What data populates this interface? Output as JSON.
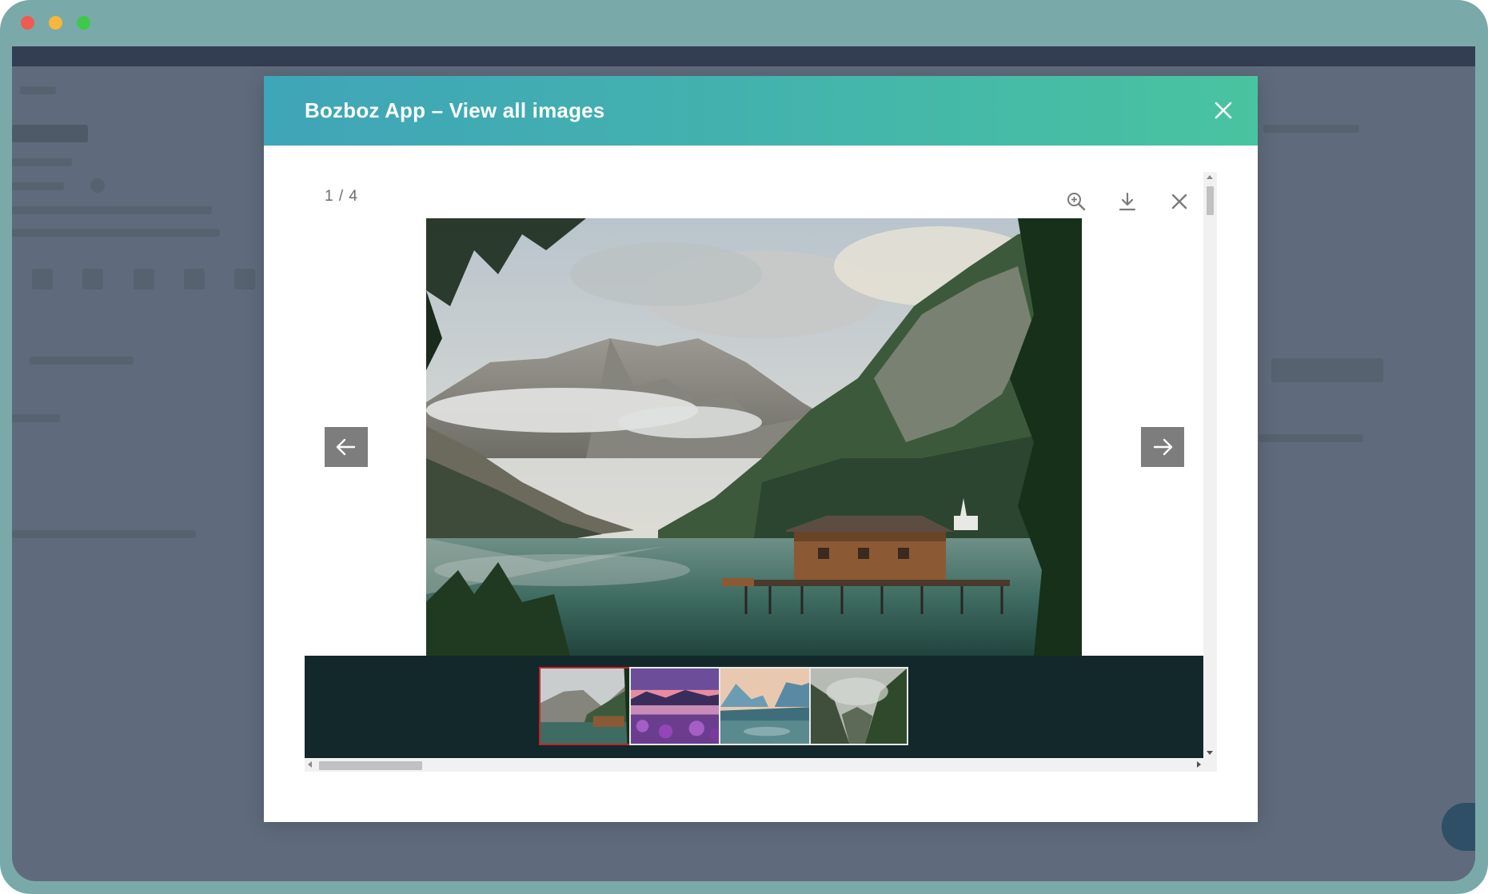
{
  "window": {
    "controls": [
      "close",
      "minimize",
      "maximize"
    ]
  },
  "modal": {
    "title": "Bozboz App – View all images",
    "close_icon": "close-icon"
  },
  "viewer": {
    "counter": "1 / 4",
    "current_index": 1,
    "total": 4,
    "toolbar": {
      "zoom_icon": "zoom-in-icon",
      "download_icon": "download-icon",
      "close_icon": "close-icon"
    },
    "nav": {
      "prev_icon": "arrow-left-icon",
      "next_icon": "arrow-right-icon"
    },
    "main_image": "mountain-lake-boathouse",
    "thumbnails": [
      {
        "subject": "mountain-lake-boathouse",
        "active": true
      },
      {
        "subject": "purple-flowers-sunset-lake",
        "active": false
      },
      {
        "subject": "misty-blue-mountains-river",
        "active": false
      },
      {
        "subject": "forested-gorge-mist",
        "active": false
      }
    ]
  },
  "colors": {
    "header_start": "#3fa5b8",
    "header_end": "#49c3a0",
    "thumb_strip_bg": "#13282a",
    "active_thumb_border": "#c0262d",
    "nav_button_bg": "#7d7d7d"
  }
}
